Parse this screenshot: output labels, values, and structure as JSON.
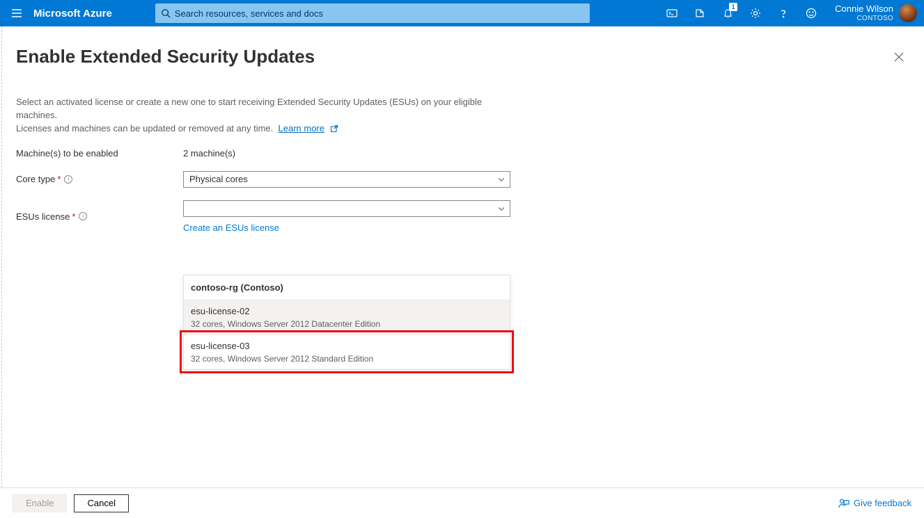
{
  "header": {
    "brand": "Microsoft Azure",
    "search_placeholder": "Search resources, services and docs",
    "notification_count": "1",
    "user_name": "Connie Wilson",
    "tenant": "CONTOSO"
  },
  "panel": {
    "title": "Enable Extended Security Updates",
    "desc_line1": "Select an activated license or create a new one to start receiving Extended Security Updates (ESUs) on your eligible machines.",
    "desc_line2_prefix": "Licenses and machines can be updated or removed at any time.",
    "learn_more": "Learn more",
    "labels": {
      "machines": "Machine(s) to be enabled",
      "core_type": "Core type",
      "esus_license": "ESUs license"
    },
    "values": {
      "machines": "2 machine(s)"
    },
    "core_type_selected": "Physical cores",
    "esus_license_selected": "",
    "create_link": "Create an ESUs license"
  },
  "dropdown": {
    "group_header": "contoso-rg (Contoso)",
    "items": [
      {
        "name": "esu-license-02",
        "detail": "32 cores, Windows Server 2012 Datacenter Edition"
      },
      {
        "name": "esu-license-03",
        "detail": "32 cores, Windows Server 2012 Standard Edition"
      }
    ]
  },
  "footer": {
    "enable": "Enable",
    "cancel": "Cancel",
    "feedback": "Give feedback"
  }
}
